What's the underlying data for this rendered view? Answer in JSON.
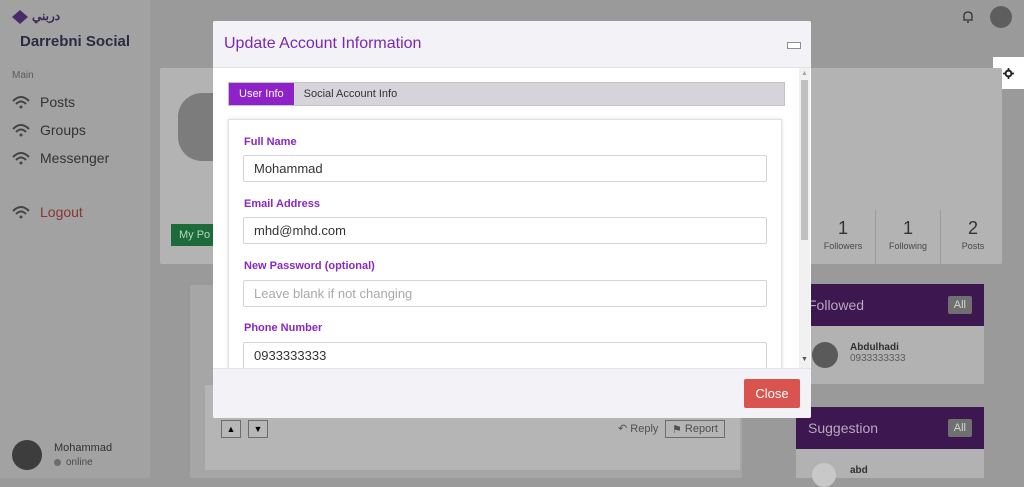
{
  "app": {
    "logo_text": "دربني",
    "brand": "Darrebni Social"
  },
  "sidebar": {
    "section_label": "Main",
    "items": [
      {
        "label": "Posts",
        "icon": "wifi-icon"
      },
      {
        "label": "Groups",
        "icon": "wifi-icon"
      },
      {
        "label": "Messenger",
        "icon": "wifi-icon"
      },
      {
        "label": "Logout",
        "icon": "wifi-icon"
      }
    ],
    "user": {
      "name": "Mohammad",
      "status": "online"
    }
  },
  "profile": {
    "my_posts_label": "My Po",
    "stats": [
      {
        "value": "1",
        "label": "Followers"
      },
      {
        "value": "1",
        "label": "Following"
      },
      {
        "value": "2",
        "label": "Posts"
      }
    ]
  },
  "post": {
    "reply_label": "Reply",
    "report_label": "Report"
  },
  "followed_panel": {
    "title": "Followed",
    "all_label": "All",
    "items": [
      {
        "name": "Abdulhadi",
        "phone": "0933333333"
      }
    ]
  },
  "suggestion_panel": {
    "title": "Suggestion",
    "all_label": "All",
    "items": [
      {
        "name": "abd"
      }
    ]
  },
  "modal": {
    "title": "Update Account Information",
    "tabs": [
      {
        "label": "User Info",
        "active": true
      },
      {
        "label": "Social Account Info",
        "active": false
      }
    ],
    "fields": {
      "full_name": {
        "label": "Full Name",
        "value": "Mohammad"
      },
      "email": {
        "label": "Email Address",
        "value": "mhd@mhd.com"
      },
      "password": {
        "label": "New Password (optional)",
        "value": "",
        "placeholder": "Leave blank if not changing"
      },
      "phone": {
        "label": "Phone Number",
        "value": "0933333333"
      }
    },
    "close_label": "Close"
  },
  "colors": {
    "accent": "#8e21c8",
    "title": "#7a28b2",
    "danger": "#d9534f"
  }
}
